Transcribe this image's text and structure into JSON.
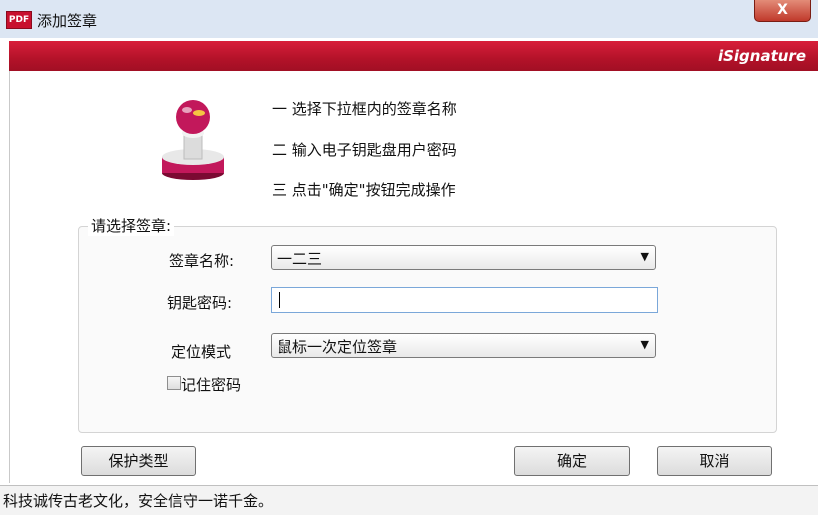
{
  "window": {
    "title": "添加签章",
    "app_icon": "pdf-icon",
    "app_icon_text": "PDF",
    "close_label": "X"
  },
  "banner": {
    "brand": "iSignature"
  },
  "instructions": [
    "一 选择下拉框内的签章名称",
    "二 输入电子钥匙盘用户密码",
    "三 点击\"确定\"按钮完成操作"
  ],
  "form": {
    "group_label": "请选择签章:",
    "seal_name_label": "签章名称:",
    "seal_name_value": "一二三",
    "key_password_label": "钥匙密码:",
    "key_password_value": "",
    "position_mode_label": "定位模式",
    "position_mode_value": "鼠标一次定位签章",
    "remember_password_label": "记住密码",
    "remember_password_checked": false
  },
  "buttons": {
    "protect_type": "保护类型",
    "ok": "确定",
    "cancel": "取消"
  },
  "status_bar": {
    "text": "科技诚传古老文化，安全信守一诺千金。"
  },
  "colors": {
    "banner_red": "#b31229",
    "titlebar": "#dce6f3",
    "stamp_pink": "#c2185b"
  }
}
